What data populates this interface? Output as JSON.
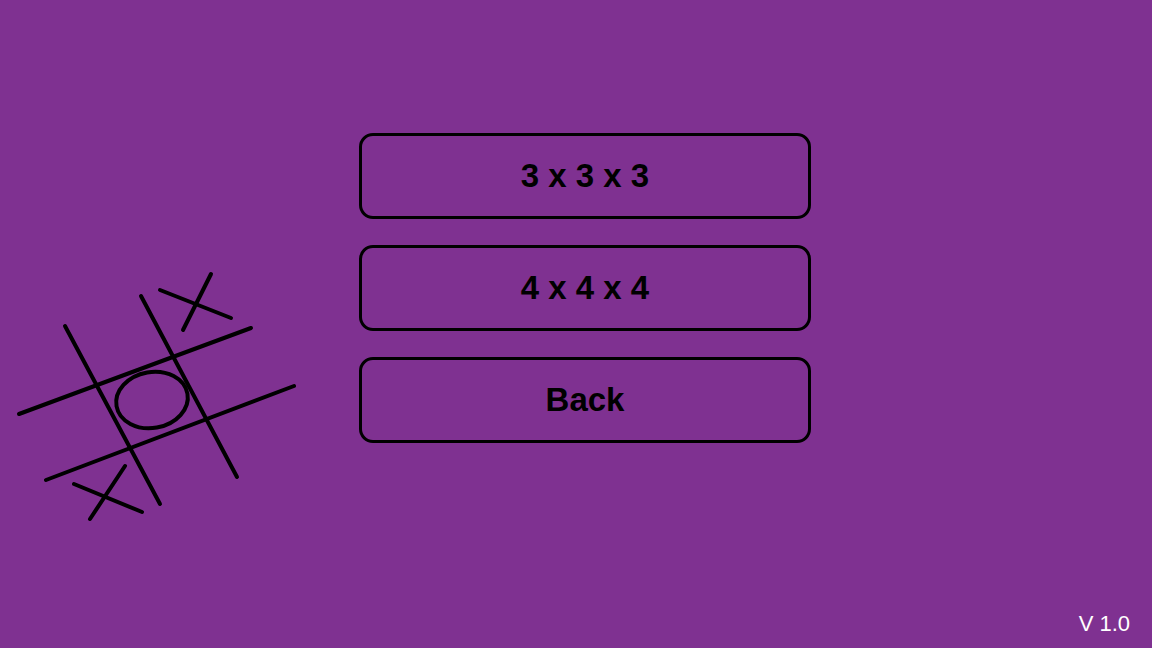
{
  "menu": {
    "buttons": [
      {
        "label": "3 x 3 x 3"
      },
      {
        "label": "4 x 4 x 4"
      },
      {
        "label": "Back"
      }
    ]
  },
  "version": "V 1.0"
}
